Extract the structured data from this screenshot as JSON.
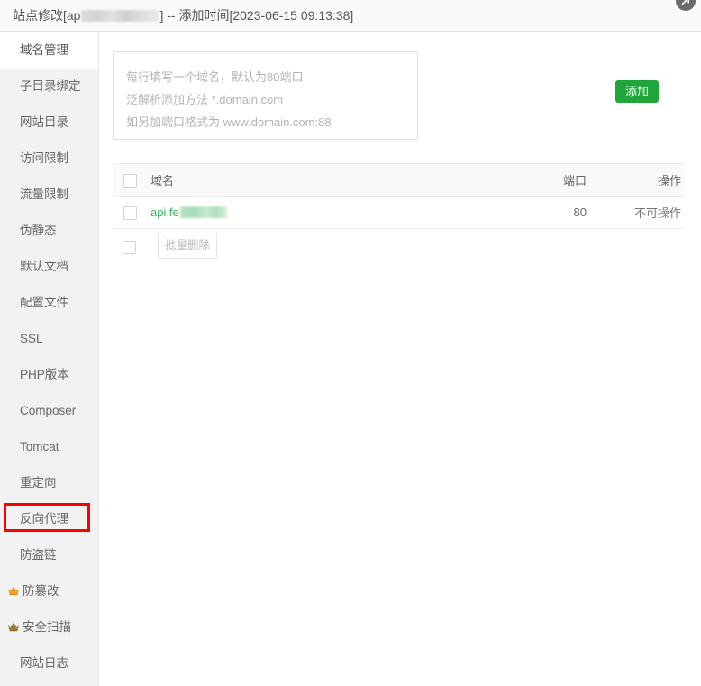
{
  "titlebar": {
    "prefix": "站点修改[ap",
    "middle": "] -- 添加时间[",
    "timestamp": "2023-06-15 09:13:38",
    "suffix": "]",
    "close_icon": "expand-arrow-icon"
  },
  "sidebar": {
    "items": [
      {
        "label": "域名管理",
        "active": true,
        "icon": null,
        "highlight": false
      },
      {
        "label": "子目录绑定",
        "active": false,
        "icon": null,
        "highlight": false
      },
      {
        "label": "网站目录",
        "active": false,
        "icon": null,
        "highlight": false
      },
      {
        "label": "访问限制",
        "active": false,
        "icon": null,
        "highlight": false
      },
      {
        "label": "流量限制",
        "active": false,
        "icon": null,
        "highlight": false
      },
      {
        "label": "伪静态",
        "active": false,
        "icon": null,
        "highlight": false
      },
      {
        "label": "默认文档",
        "active": false,
        "icon": null,
        "highlight": false
      },
      {
        "label": "配置文件",
        "active": false,
        "icon": null,
        "highlight": false
      },
      {
        "label": "SSL",
        "active": false,
        "icon": null,
        "highlight": false
      },
      {
        "label": "PHP版本",
        "active": false,
        "icon": null,
        "highlight": false
      },
      {
        "label": "Composer",
        "active": false,
        "icon": null,
        "highlight": false
      },
      {
        "label": "Tomcat",
        "active": false,
        "icon": null,
        "highlight": false
      },
      {
        "label": "重定向",
        "active": false,
        "icon": null,
        "highlight": false
      },
      {
        "label": "反向代理",
        "active": false,
        "icon": null,
        "highlight": true
      },
      {
        "label": "防盗链",
        "active": false,
        "icon": null,
        "highlight": false
      },
      {
        "label": "防篡改",
        "active": false,
        "icon": "crown-icon",
        "iconColor": "#f0a020",
        "highlight": false
      },
      {
        "label": "安全扫描",
        "active": false,
        "icon": "crown-icon",
        "iconColor": "#a07c30",
        "highlight": false
      },
      {
        "label": "网站日志",
        "active": false,
        "icon": null,
        "highlight": false
      }
    ]
  },
  "main": {
    "domain_input": {
      "placeholder_lines": [
        "每行填写一个域名，默认为80端口",
        "泛解析添加方法 *.domain.com",
        "如另加端口格式为 www.domain.com:88"
      ],
      "value": ""
    },
    "add_button": {
      "label": "添加",
      "color": "#20a53a"
    },
    "table": {
      "headers": {
        "domain": "域名",
        "port": "端口",
        "action": "操作"
      },
      "rows": [
        {
          "domain": "api.fe",
          "domain_redacted": true,
          "port": "80",
          "action": "不可操作"
        }
      ]
    },
    "bulk_delete_button": {
      "label": "批量删除",
      "disabled": true
    }
  }
}
